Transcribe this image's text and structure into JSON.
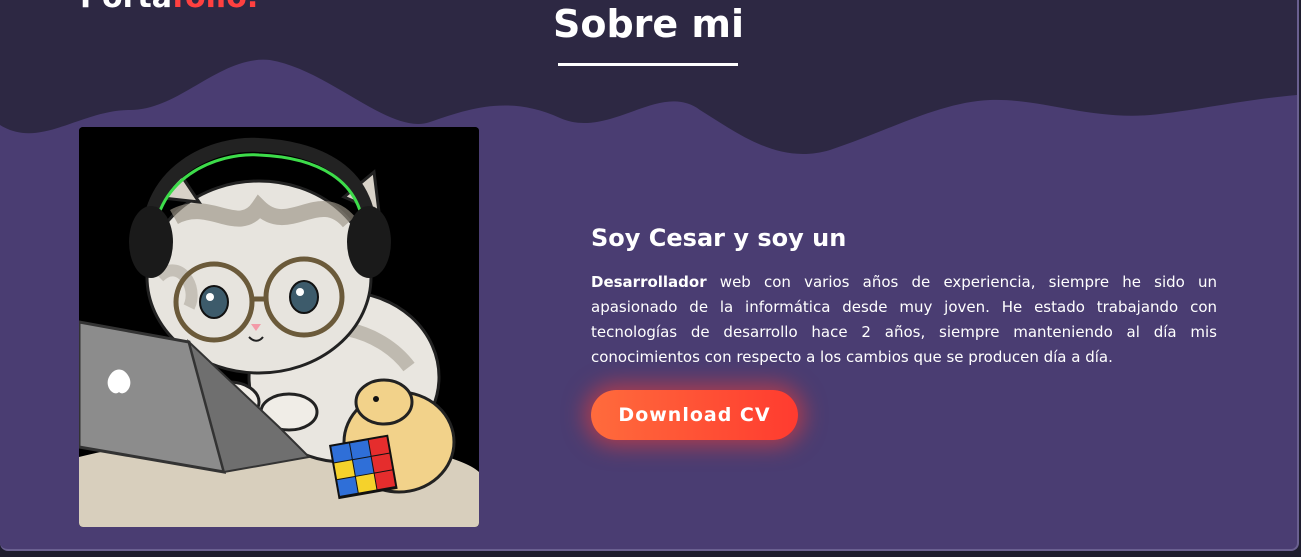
{
  "header": {
    "logo_main": "Porta",
    "logo_accent": "folio."
  },
  "about": {
    "section_title": "Sobre mi",
    "subtitle": "Soy Cesar y soy un",
    "description_bold": "Desarrollador",
    "description_rest": " web con varios años de experiencia, siempre he sido un apasionado de la informática desde muy joven. He estado trabajando con tecnologías de desarrollo hace 2 años, siempre manteniendo al día mis conocimientos con respecto a los cambios que se producen día a día.",
    "download_button": "Download CV",
    "portrait_icon": "cat-with-headphones-illustration"
  },
  "colors": {
    "background": "#4a3d72",
    "wave": "#2a263f",
    "accent": "#ff4040",
    "button_gradient_start": "#ff6b3c",
    "button_gradient_end": "#ff3b2f"
  }
}
